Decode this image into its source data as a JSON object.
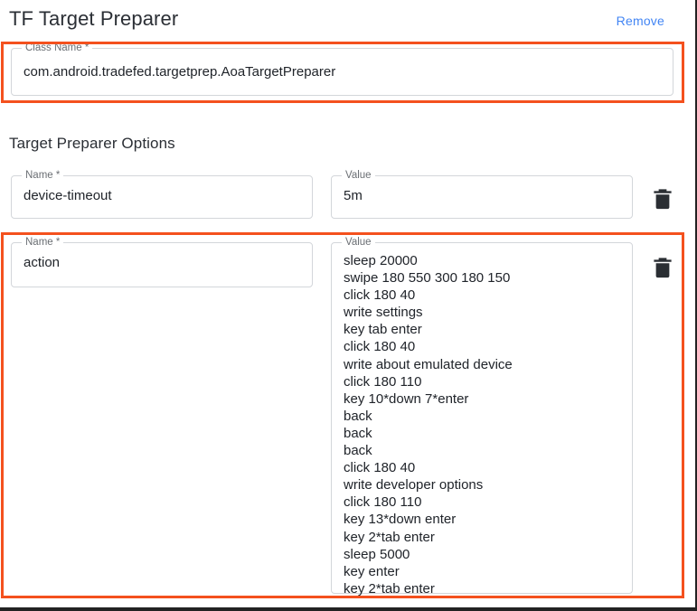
{
  "header": {
    "title": "TF Target Preparer",
    "remove_label": "Remove",
    "remove_color": "#4285f4"
  },
  "class_name_field": {
    "label": "Class Name *",
    "value": "com.android.tradefed.targetprep.AoaTargetPreparer"
  },
  "options_section": {
    "title": "Target Preparer Options",
    "rows": [
      {
        "name_label": "Name *",
        "name_value": "device-timeout",
        "value_label": "Value",
        "value_value": "5m",
        "delete_icon": "trash-icon"
      },
      {
        "name_label": "Name *",
        "name_value": "action",
        "value_label": "Value",
        "value_value": "sleep 20000\nswipe 180 550 300 180 150\nclick 180 40\nwrite settings\nkey tab enter\nclick 180 40\nwrite about emulated device\nclick 180 110\nkey 10*down 7*enter\nback\nback\nback\nclick 180 40\nwrite developer options\nclick 180 110\nkey 13*down enter\nkey 2*tab enter\nsleep 5000\nkey enter\nkey 2*tab enter",
        "delete_icon": "trash-icon"
      }
    ]
  },
  "annotations": {
    "color": "#f4511e",
    "boxes": [
      {
        "target": "class-name-field"
      },
      {
        "target": "action-option-row"
      }
    ]
  }
}
